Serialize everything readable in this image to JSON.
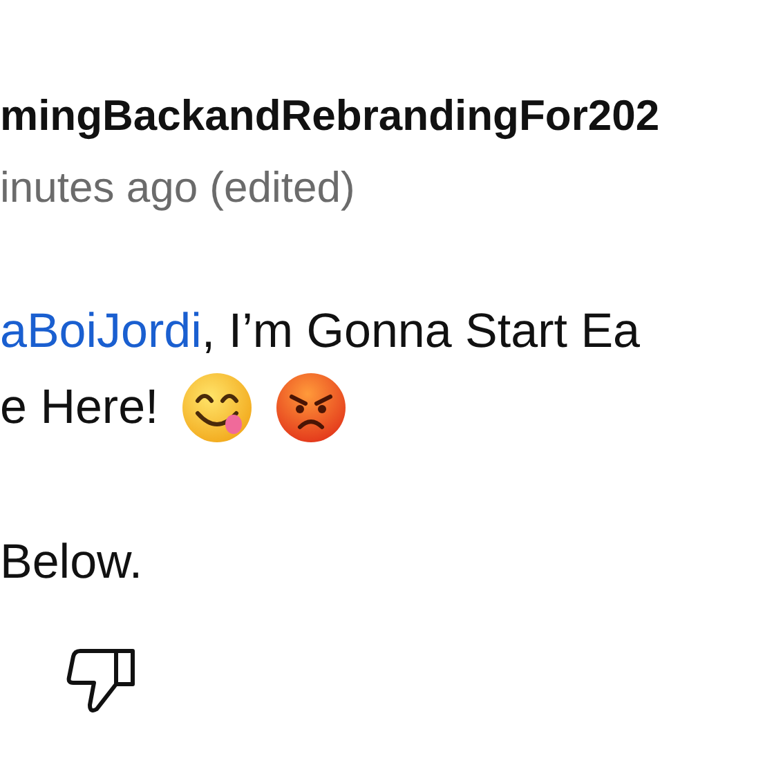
{
  "author": {
    "name": "mingBackandRebrandingFor202"
  },
  "timestamp": "inutes ago (edited)",
  "paragraphs": [
    [
      [
        {
          "kind": "mention",
          "text": "aBoiJordi"
        },
        {
          "kind": "text",
          "text": ", I’m Gonna Start Ea"
        }
      ],
      [
        {
          "kind": "text",
          "text": "e Here!"
        },
        {
          "kind": "yum"
        },
        {
          "kind": "angry"
        }
      ]
    ],
    [
      [
        {
          "kind": "text",
          "text": "Below."
        }
      ]
    ]
  ],
  "actions": [
    {
      "kind": "dislike"
    }
  ]
}
